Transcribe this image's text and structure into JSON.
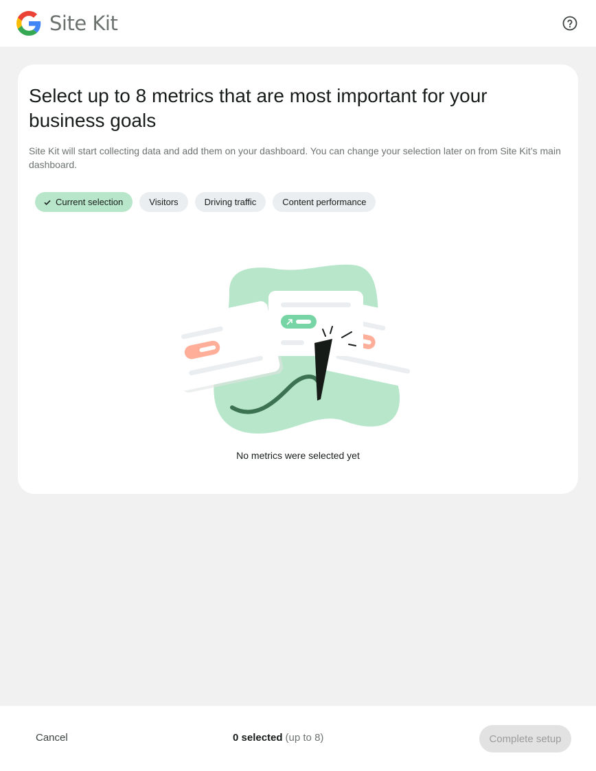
{
  "header": {
    "app_name": "Site Kit",
    "logo_icon": "google-g-icon",
    "help_icon": "help-circle-icon"
  },
  "card": {
    "title": "Select up to 8 metrics that are most important for your business goals",
    "subtitle": "Site Kit will start collecting data and add them on your dashboard. You can change your selection later on from Site Kit’s main dashboard.",
    "chips": [
      {
        "label": "Current selection",
        "active": true,
        "icon": "check-icon"
      },
      {
        "label": "Visitors",
        "active": false
      },
      {
        "label": "Driving traffic",
        "active": false
      },
      {
        "label": "Content performance",
        "active": false
      }
    ],
    "empty_message": "No metrics were selected yet"
  },
  "footer": {
    "cancel_label": "Cancel",
    "selected_count": "0 selected",
    "selected_limit": "(up to 8)",
    "complete_label": "Complete setup"
  },
  "colors": {
    "page_bg": "#f1f1f1",
    "active_chip": "#b8e6ca",
    "chip": "#ebeef0",
    "disabled_button": "#e2e2e2"
  }
}
